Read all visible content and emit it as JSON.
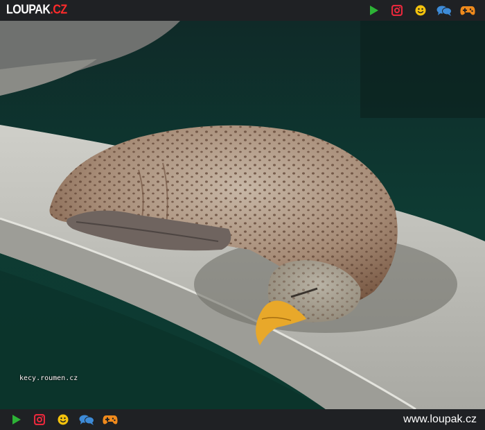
{
  "header": {
    "logo_brand": "LOUPAK",
    "logo_tld": ".CZ"
  },
  "icons": [
    {
      "name": "play-icon",
      "color": "#2db336"
    },
    {
      "name": "instagram-icon",
      "color": "#e8283c"
    },
    {
      "name": "smiley-icon",
      "color": "#f4c20d"
    },
    {
      "name": "chat-bubbles-icon",
      "color": "#3d8bd8"
    },
    {
      "name": "gamepad-icon",
      "color": "#f08a1c"
    }
  ],
  "photo": {
    "watermark": "kecy.roumen.cz"
  },
  "footer": {
    "site_url": "www.loupak.cz"
  }
}
